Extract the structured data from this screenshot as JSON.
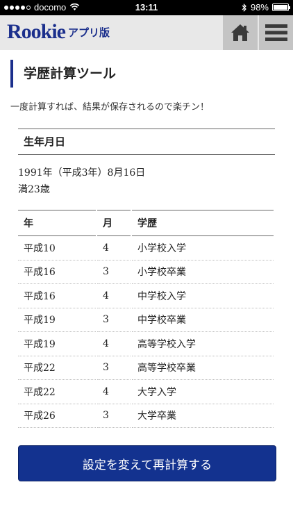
{
  "status_bar": {
    "carrier": "docomo",
    "time": "13:11",
    "battery_percent": "98%",
    "battery_level": 0.98
  },
  "header": {
    "logo_text": "Rookie",
    "logo_sub": "アプリ版",
    "home_icon": "home-icon",
    "menu_icon": "hamburger-menu-icon",
    "brand_color": "#1b2f8c"
  },
  "page": {
    "title": "学歴計算ツール",
    "description": "一度計算すれば、結果が保存されるので楽チン！"
  },
  "birth": {
    "heading": "生年月日",
    "date": "1991年（平成3年）8月16日",
    "age": "満23歳"
  },
  "table": {
    "headers": [
      "年",
      "月",
      "学歴"
    ],
    "rows": [
      {
        "year": "平成10",
        "month": "4",
        "edu": "小学校入学"
      },
      {
        "year": "平成16",
        "month": "3",
        "edu": "小学校卒業"
      },
      {
        "year": "平成16",
        "month": "4",
        "edu": "中学校入学"
      },
      {
        "year": "平成19",
        "month": "3",
        "edu": "中学校卒業"
      },
      {
        "year": "平成19",
        "month": "4",
        "edu": "高等学校入学"
      },
      {
        "year": "平成22",
        "month": "3",
        "edu": "高等学校卒業"
      },
      {
        "year": "平成22",
        "month": "4",
        "edu": "大学入学"
      },
      {
        "year": "平成26",
        "month": "3",
        "edu": "大学卒業"
      }
    ]
  },
  "recalc_button": {
    "label": "設定を変えて再計算する",
    "color": "#13328f"
  }
}
